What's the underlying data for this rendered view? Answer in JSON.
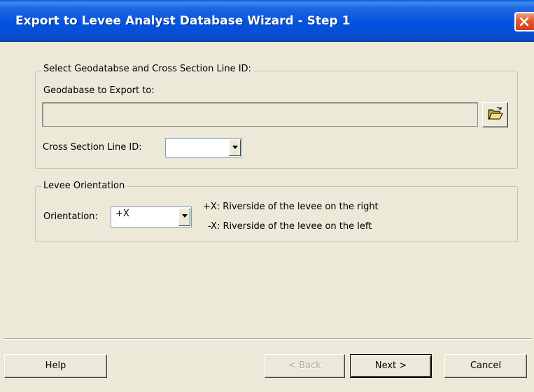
{
  "window": {
    "title": "Export to Levee Analyst Database Wizard - Step 1",
    "close_icon": "close-icon"
  },
  "geodatabase_group": {
    "legend": "Select Geodatabse and Cross Section Line ID:",
    "geodatabase_label": "Geodabase to Export to:",
    "geodatabase_value": "",
    "browse_icon": "open-folder-icon",
    "cross_section_label": "Cross Section Line ID:",
    "cross_section_value": ""
  },
  "orientation_group": {
    "legend": "Levee Orientation",
    "orientation_label": "Orientation:",
    "orientation_value": "+X",
    "hint_plus": "+X: Riverside of the levee on the right",
    "hint_minus": "-X: Riverside of the levee on the left"
  },
  "buttons": {
    "help": "Help",
    "back": "< Back",
    "back_enabled": false,
    "next": "Next >",
    "cancel": "Cancel"
  },
  "colors": {
    "titlebar": "#0054e3",
    "face": "#ece9d8",
    "close_button": "#e2572f"
  }
}
